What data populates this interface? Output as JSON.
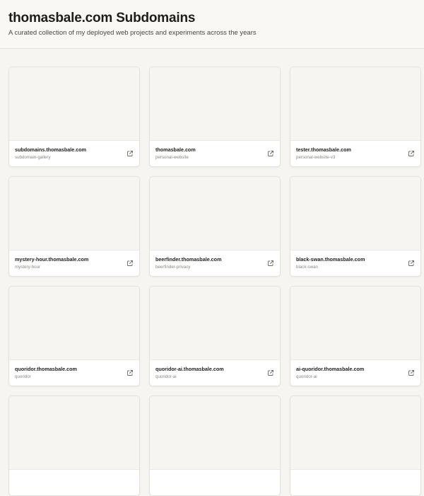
{
  "header": {
    "title": "thomasbale.com Subdomains",
    "subtitle": "A curated collection of my deployed web projects and experiments across the years"
  },
  "cards": [
    {
      "domain": "subdomains.thomasbale.com",
      "slug": "subdomain-gallery",
      "icon": "external-link-icon"
    },
    {
      "domain": "thomasbale.com",
      "slug": "personal-website",
      "icon": "external-link-icon"
    },
    {
      "domain": "tester.thomasbale.com",
      "slug": "personal-website-v3",
      "icon": "external-link-icon"
    },
    {
      "domain": "mystery-hour.thomasbale.com",
      "slug": "mystery-hour",
      "icon": "external-link-icon"
    },
    {
      "domain": "beerfinder.thomasbale.com",
      "slug": "beerfinder-privacy",
      "icon": "external-link-icon"
    },
    {
      "domain": "black-swan.thomasbale.com",
      "slug": "black-swan",
      "icon": "external-link-icon"
    },
    {
      "domain": "quoridor.thomasbale.com",
      "slug": "quoridor",
      "icon": "external-link-icon"
    },
    {
      "domain": "quoridor-ai.thomasbale.com",
      "slug": "quoridor-ai",
      "icon": "external-link-icon"
    },
    {
      "domain": "ai-quoridor.thomasbale.com",
      "slug": "quoridor-ai",
      "icon": "external-link-icon"
    },
    {
      "domain": "",
      "slug": "",
      "icon": ""
    },
    {
      "domain": "",
      "slug": "",
      "icon": ""
    },
    {
      "domain": "",
      "slug": "",
      "icon": ""
    }
  ],
  "colors": {
    "background": "#f6f5f1",
    "card": "#ffffff",
    "text": "#1f1d1a",
    "muted": "#8a867e"
  }
}
